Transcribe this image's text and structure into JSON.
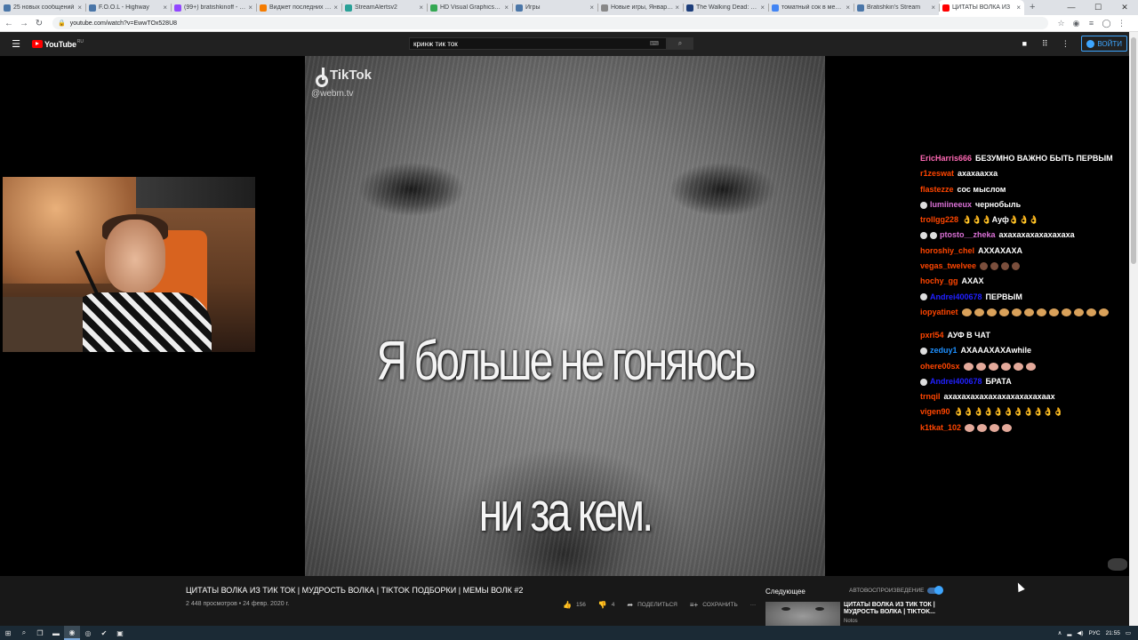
{
  "browser": {
    "tabs": [
      {
        "label": "25 новых сообщений",
        "color": "#4a76a8"
      },
      {
        "label": "F.O.O.L - Highway",
        "color": "#4a76a8"
      },
      {
        "label": "(99+) bratishkinoff - Tw",
        "color": "#9146ff"
      },
      {
        "label": "Виджет последних соо",
        "color": "#f57c00"
      },
      {
        "label": "StreamAlertsv2",
        "color": "#2aa198"
      },
      {
        "label": "HD Visual Graphics© - ",
        "color": "#34a853"
      },
      {
        "label": "Игры",
        "color": "#4a76a8"
      },
      {
        "label": "Новые игры, Январь 20",
        "color": "#888888"
      },
      {
        "label": "The Walking Dead: Sain",
        "color": "#1c3d7a"
      },
      {
        "label": "томатный сок в мексик",
        "color": "#4285f4"
      },
      {
        "label": "Bratishkin's Stream",
        "color": "#4a76a8"
      },
      {
        "label": "ЦИТАТЫ ВОЛКА ИЗ",
        "color": "#ff0000",
        "active": true
      }
    ],
    "new_tab": "+",
    "url": "youtube.com/watch?v=EwwTOx528U8"
  },
  "youtube": {
    "logo": "YouTube",
    "logo_suffix": "RU",
    "search_value": "кринж тик ток",
    "signin_label": "ВОЙТИ"
  },
  "video": {
    "tiktok_brand": "TikTok",
    "tiktok_handle": "@webm.tv",
    "caption_line1": "Я больше не гоняюсь",
    "caption_line2": "ни за кем."
  },
  "chat": [
    {
      "nick": "EricHarris666",
      "color": "#ff69b4",
      "msg": "БЕЗУМНО ВАЖНО БЫТЬ ПЕРВЫМ"
    },
    {
      "nick": "r1zeswat",
      "color": "#ff4500",
      "msg": "ахахаахха"
    },
    {
      "nick": "flastezze",
      "color": "#ff4500",
      "msg": "сос мыслом"
    },
    {
      "nick": "lumiineeux",
      "color": "#da70d6",
      "msg": "чернобыль",
      "badges": 1
    },
    {
      "nick": "trollgg228",
      "color": "#ff4500",
      "msg": "👌👌👌Ауф👌👌👌"
    },
    {
      "nick": "ptosto__zheka",
      "color": "#da70d6",
      "msg": "ахахахахахахахаха",
      "badges": 2
    },
    {
      "nick": "horoshiy_chel",
      "color": "#ff4500",
      "msg": "АХХАХАХА"
    },
    {
      "nick": "vegas_twelvee",
      "color": "#ff4500",
      "msg": "",
      "emotes": 4,
      "emote_kind": "dark"
    },
    {
      "nick": "hochy_gg",
      "color": "#ff4500",
      "msg": "АХАХ"
    },
    {
      "nick": "Andrei400678",
      "color": "#2020ff",
      "msg": "ПЕРВЫМ",
      "badges": 1
    },
    {
      "nick": "iopyatinet",
      "color": "#ff4500",
      "msg": "",
      "emotes": 12,
      "emote_kind": "cool",
      "tall": true
    },
    {
      "nick": "pxrl54",
      "color": "#ff4500",
      "msg": "АУФ В ЧАТ"
    },
    {
      "nick": "zeduy1",
      "color": "#1e90ff",
      "msg": "АХАААХАХАwhile",
      "badges": 1
    },
    {
      "nick": "ohere00sx",
      "color": "#ff4500",
      "msg": "",
      "emotes": 6
    },
    {
      "nick": "Andrei400678",
      "color": "#2020ff",
      "msg": "БРАТА",
      "badges": 1
    },
    {
      "nick": "trnqil",
      "color": "#ff4500",
      "msg": "ахахахахахахахахахахахаах"
    },
    {
      "nick": "vigen90",
      "color": "#ff4500",
      "msg": "👌👌👌👌👌👌👌👌👌👌👌"
    },
    {
      "nick": "k1tkat_102",
      "color": "#ff4500",
      "msg": "",
      "emotes": 4
    }
  ],
  "info": {
    "title": "ЦИТАТЫ ВОЛКА ИЗ ТИК ТОК | МУДРОСТЬ ВОЛКА | TIKTOK ПОДБОРКИ | МЕМЫ ВОЛК #2",
    "meta": "2 448 просмотров • 24 февр. 2020 г.",
    "likes": "156",
    "dislikes": "4",
    "share": "ПОДЕЛИТЬСЯ",
    "save": "СОХРАНИТЬ",
    "more": "···",
    "next_label": "Следующее",
    "autoplay_label": "АВТОВОСПРОИЗВЕДЕНИЕ",
    "next_title": "ЦИТАТЫ ВОЛКА ИЗ ТИК ТОК | МУДРОСТЬ ВОЛКА | TIKTOK...",
    "next_channel": "Notos"
  },
  "taskbar": {
    "lang": "РУС",
    "time": "21:55"
  }
}
